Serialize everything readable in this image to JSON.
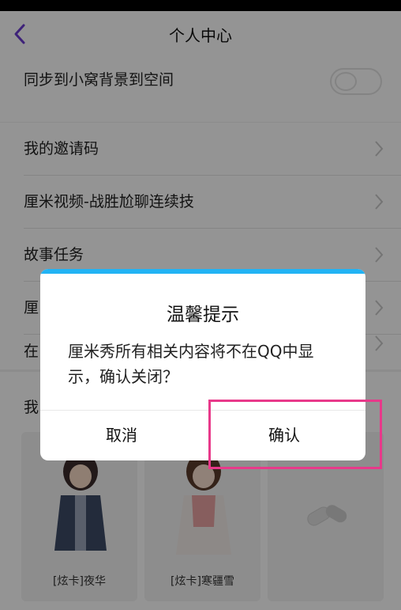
{
  "nav": {
    "title": "个人中心"
  },
  "rows": {
    "sync": "同步到小窝背景到空间",
    "invite": "我的邀请码",
    "video": "厘米视频-战胜尬聊连续技",
    "story": "故事任务",
    "partial1": "厘",
    "partial2": "在",
    "partial3": "我"
  },
  "toggle_sync": {
    "state": "off"
  },
  "cards": [
    {
      "caption": "[炫卡]夜华"
    },
    {
      "caption": "[炫卡]寒疆雪"
    },
    {
      "caption": ""
    }
  ],
  "dialog": {
    "title": "温馨提示",
    "message": "厘米秀所有相关内容将不在QQ中显示，确认关闭？",
    "cancel": "取消",
    "confirm": "确认"
  },
  "colors": {
    "accent_bar": "#22b3f4",
    "highlight": "#e8398a",
    "back_arrow": "#6b3bd1"
  }
}
